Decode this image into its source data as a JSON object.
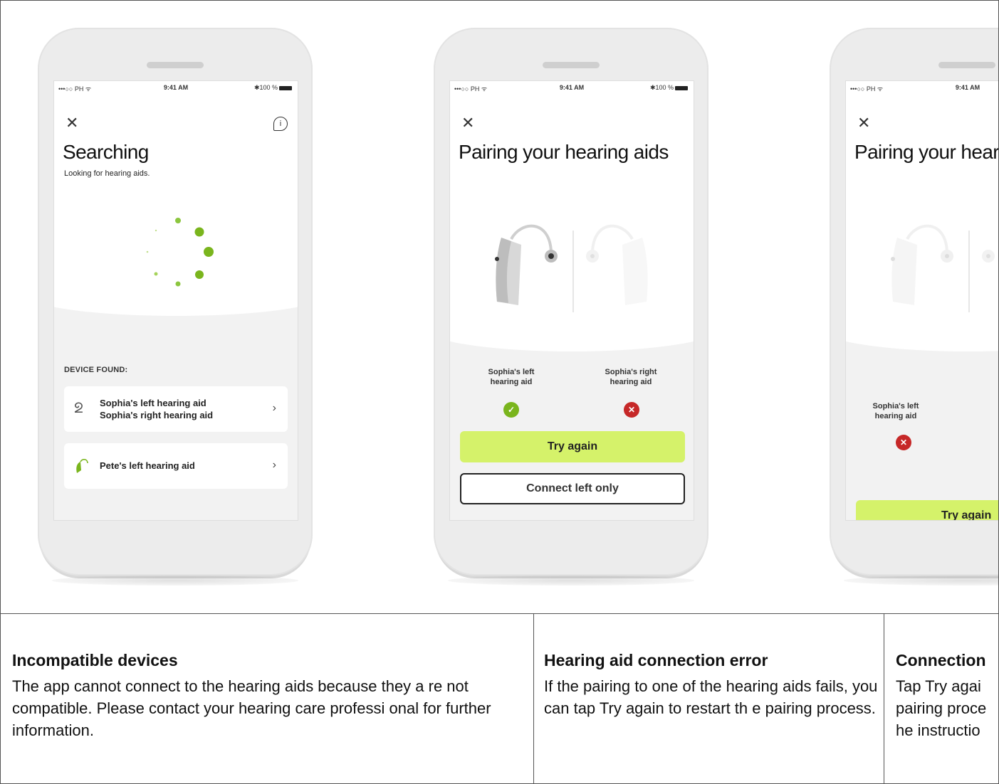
{
  "phones": [
    {
      "status": {
        "carrier": "•••○○ PH ᯤ",
        "time": "9:41 AM",
        "battery": "✱100 %"
      },
      "title": "Searching",
      "subtitle": "Looking for hearing aids.",
      "section_label": "DEVICE FOUND:",
      "devices": [
        {
          "line1": "Sophia's left hearing aid",
          "line2": "Sophia's right hearing aid",
          "icon": "hearing-aids-pair-icon"
        },
        {
          "line1": "Pete's left hearing aid",
          "line2": "",
          "icon": "hearing-aid-green-icon"
        }
      ]
    },
    {
      "status": {
        "carrier": "•••○○ PH ᯤ",
        "time": "9:41 AM",
        "battery": "✱100 %"
      },
      "title": "Pairing your hearing aids",
      "left_label": "Sophia's left hearing aid",
      "right_label": "Sophia's right hearing aid",
      "left_status": "success",
      "right_status": "error",
      "primary_button": "Try again",
      "secondary_button": "Connect left only"
    },
    {
      "status": {
        "carrier": "•••○○ PH ᯤ",
        "time": "9:41 AM"
      },
      "title": "Pairing your hearing aids",
      "left_label": "Sophia's left hearing aid",
      "left_status": "error",
      "primary_button": "Try again"
    }
  ],
  "descriptions": [
    {
      "title": "Incompatible devices",
      "text": "The app cannot connect to the hearing aids because they a re not compatible. Please contact your hearing care professi onal for further information."
    },
    {
      "title": "Hearing aid connection error",
      "text": "If the pairing to one of the hearing aids fails, you can tap Try again to restart th e pairing process."
    },
    {
      "title": "Connection",
      "text": "Tap Try agai pairing proce he instructio"
    }
  ],
  "colors": {
    "accent": "#d5f26a",
    "success": "#7ab51d",
    "error": "#c62828",
    "spinner": "#7ab51d"
  }
}
